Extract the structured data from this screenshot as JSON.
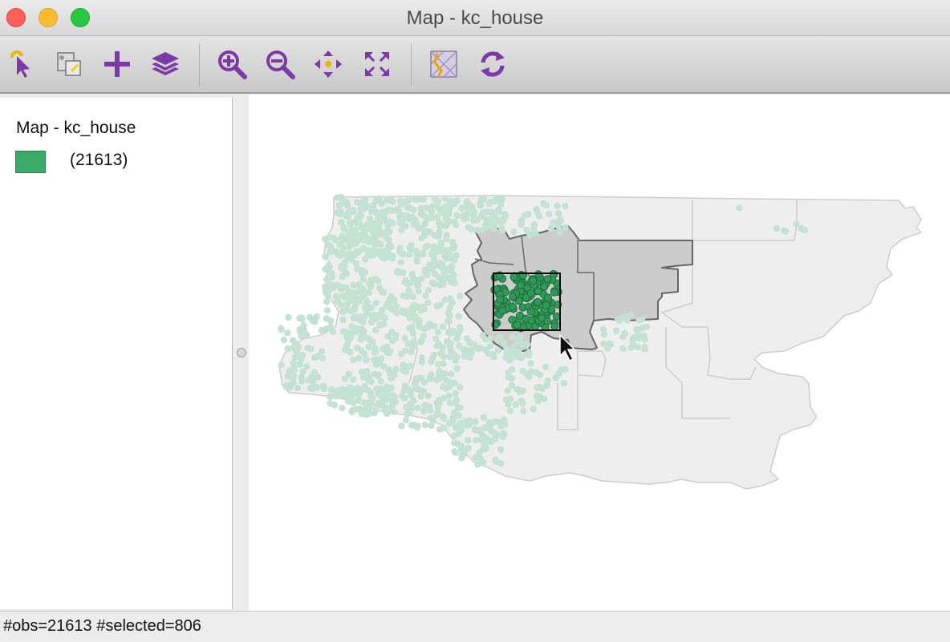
{
  "window": {
    "title": "Map - kc_house"
  },
  "toolbar": {
    "buttons": [
      {
        "name": "select-tool-icon"
      },
      {
        "name": "selection-shape-icon"
      },
      {
        "name": "add-layer-icon"
      },
      {
        "name": "layers-icon"
      },
      {
        "name": "zoom-in-icon"
      },
      {
        "name": "zoom-out-icon"
      },
      {
        "name": "pan-icon"
      },
      {
        "name": "full-extent-icon"
      },
      {
        "name": "basemap-icon"
      },
      {
        "name": "refresh-icon"
      }
    ]
  },
  "legend": {
    "title": "Map - kc_house",
    "items": [
      {
        "label": "(21613)",
        "color": "#3aaa67"
      }
    ]
  },
  "map": {
    "layer": "kc_house",
    "colors": {
      "base_fill": "#eeeeee",
      "base_border": "#cccccc",
      "selected_region_fill": "#cccccc",
      "selected_region_border": "#666666",
      "point_unselected": "#c4e2d2",
      "point_selected": "#2f9a57",
      "point_selected_stroke": "#1f6b3c",
      "brush": "#000000"
    }
  },
  "status": {
    "text": "#obs=21613 #selected=806"
  }
}
